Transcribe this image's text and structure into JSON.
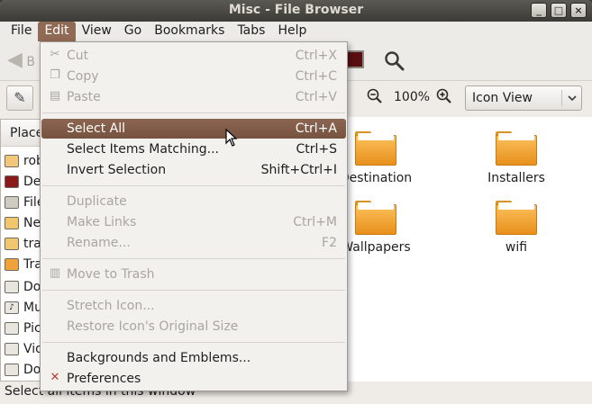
{
  "window": {
    "title": "Misc - File Browser",
    "buttons": [
      "_",
      "□",
      "×"
    ]
  },
  "menubar": [
    {
      "label": "File",
      "active": false
    },
    {
      "label": "Edit",
      "active": true
    },
    {
      "label": "View",
      "active": false
    },
    {
      "label": "Go",
      "active": false
    },
    {
      "label": "Bookmarks",
      "active": false
    },
    {
      "label": "Tabs",
      "active": false
    },
    {
      "label": "Help",
      "active": false
    }
  ],
  "toolbar": {
    "back_label": "B"
  },
  "locationbar": {
    "zoom_level": "100%",
    "view_mode": "Icon View"
  },
  "sidebar": {
    "header": "Place",
    "items": [
      {
        "label": "rob",
        "icon": "home-icon"
      },
      {
        "label": "De",
        "icon": "desktop-icon"
      },
      {
        "label": "File",
        "icon": "filesystem-icon"
      },
      {
        "label": "Ne",
        "icon": "network-icon"
      },
      {
        "label": "tra",
        "icon": "drive-icon"
      },
      {
        "label": "Tra",
        "icon": "trash-icon"
      },
      {
        "label": "Do",
        "icon": "documents-icon"
      },
      {
        "label": "Mu",
        "icon": "music-icon"
      },
      {
        "label": "Pic",
        "icon": "pictures-icon"
      },
      {
        "label": "Vid",
        "icon": "videos-icon"
      },
      {
        "label": "Do",
        "icon": "downloads-icon"
      }
    ]
  },
  "files": [
    {
      "name": "Destination"
    },
    {
      "name": "Installers"
    },
    {
      "name": "Wallpapers"
    },
    {
      "name": "wifi"
    }
  ],
  "edit_menu": {
    "items": [
      {
        "label": "Cut",
        "accel": "Ctrl+X",
        "disabled": true,
        "icon": "cut-icon"
      },
      {
        "label": "Copy",
        "accel": "Ctrl+C",
        "disabled": true,
        "icon": "copy-icon"
      },
      {
        "label": "Paste",
        "accel": "Ctrl+V",
        "disabled": true,
        "icon": "paste-icon"
      },
      {
        "label": "Select All",
        "accel": "Ctrl+A",
        "disabled": false,
        "highlight": true
      },
      {
        "label": "Select Items Matching...",
        "accel": "Ctrl+S",
        "disabled": false
      },
      {
        "label": "Invert Selection",
        "accel": "Shift+Ctrl+I",
        "disabled": false
      },
      {
        "label": "Duplicate",
        "accel": "",
        "disabled": true
      },
      {
        "label": "Make Links",
        "accel": "Ctrl+M",
        "disabled": true
      },
      {
        "label": "Rename...",
        "accel": "F2",
        "disabled": true
      },
      {
        "label": "Move to Trash",
        "accel": "",
        "disabled": true,
        "icon": "trash-icon"
      },
      {
        "label": "Stretch Icon...",
        "accel": "",
        "disabled": true
      },
      {
        "label": "Restore Icon's Original Size",
        "accel": "",
        "disabled": true
      },
      {
        "label": "Backgrounds and Emblems...",
        "accel": "",
        "disabled": false
      },
      {
        "label": "Preferences",
        "accel": "",
        "disabled": false,
        "icon": "preferences-icon"
      }
    ]
  },
  "status": "Select all items in this window",
  "colors": {
    "highlight": "#7f5b47",
    "titlebar": "#3c3b37",
    "folder": "#f0a43a"
  }
}
